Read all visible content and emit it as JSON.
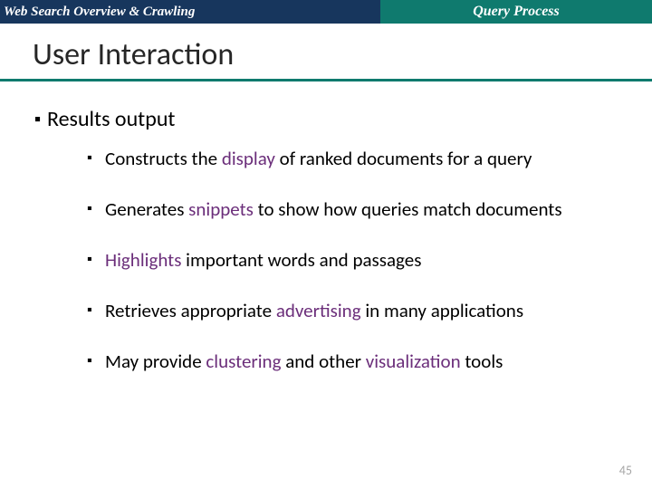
{
  "topbar": {
    "left": "Web Search Overview & Crawling",
    "right": "Query Process"
  },
  "title": "User Interaction",
  "main": {
    "heading": "Results output",
    "items": [
      {
        "pre": "Constructs the ",
        "accent": "display",
        "post": " of ranked documents for a query"
      },
      {
        "pre": "Generates ",
        "accent": "snippets",
        "post": " to show how queries match documents"
      },
      {
        "pre": "",
        "accent": "Highlights",
        "post": " important words and passages"
      },
      {
        "pre": "Retrieves appropriate ",
        "accent": "advertising",
        "post": " in many applications"
      },
      {
        "pre": "May provide ",
        "accent": "clustering",
        "post": " and other ",
        "accent2": "visualization",
        "post2": " tools"
      }
    ]
  },
  "page": "45"
}
